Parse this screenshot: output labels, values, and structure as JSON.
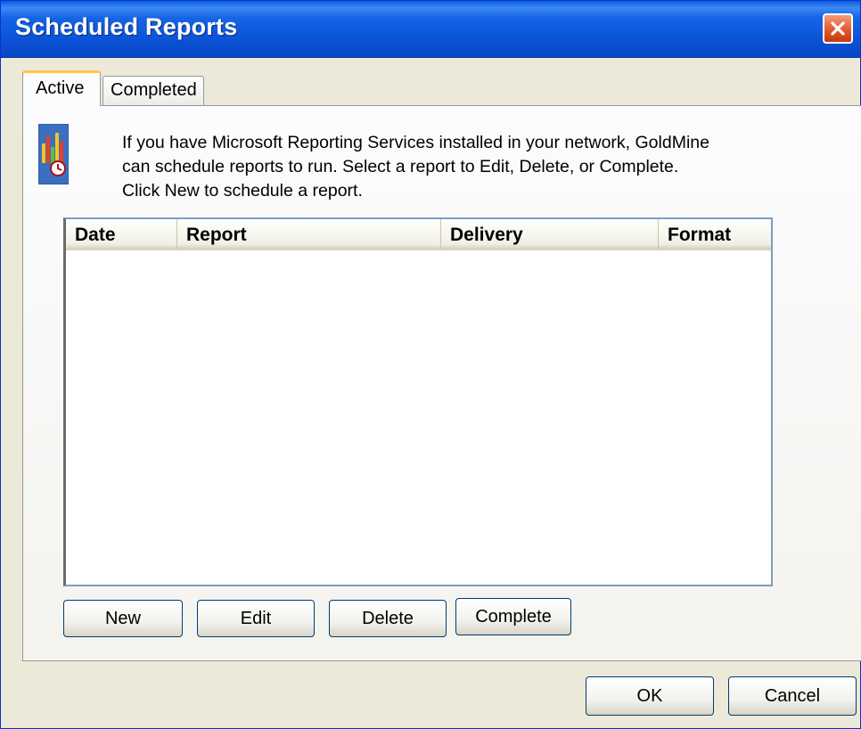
{
  "window": {
    "title": "Scheduled Reports",
    "close_icon": "close-icon"
  },
  "tabs": [
    {
      "label": "Active",
      "selected": true
    },
    {
      "label": "Completed",
      "selected": false
    }
  ],
  "info": {
    "icon": "report-chart-icon",
    "lines": [
      "If you have Microsoft Reporting Services installed in your network, GoldMine",
      "can schedule reports to run.  Select a report to Edit, Delete, or Complete.",
      "Click New to schedule a report."
    ]
  },
  "list": {
    "columns": [
      "Date",
      "Report",
      "Delivery",
      "Format"
    ],
    "rows": []
  },
  "actions": {
    "new_label": "New",
    "edit_label": "Edit",
    "delete_label": "Delete",
    "complete_label": "Complete"
  },
  "footer": {
    "ok_label": "OK",
    "cancel_label": "Cancel"
  }
}
